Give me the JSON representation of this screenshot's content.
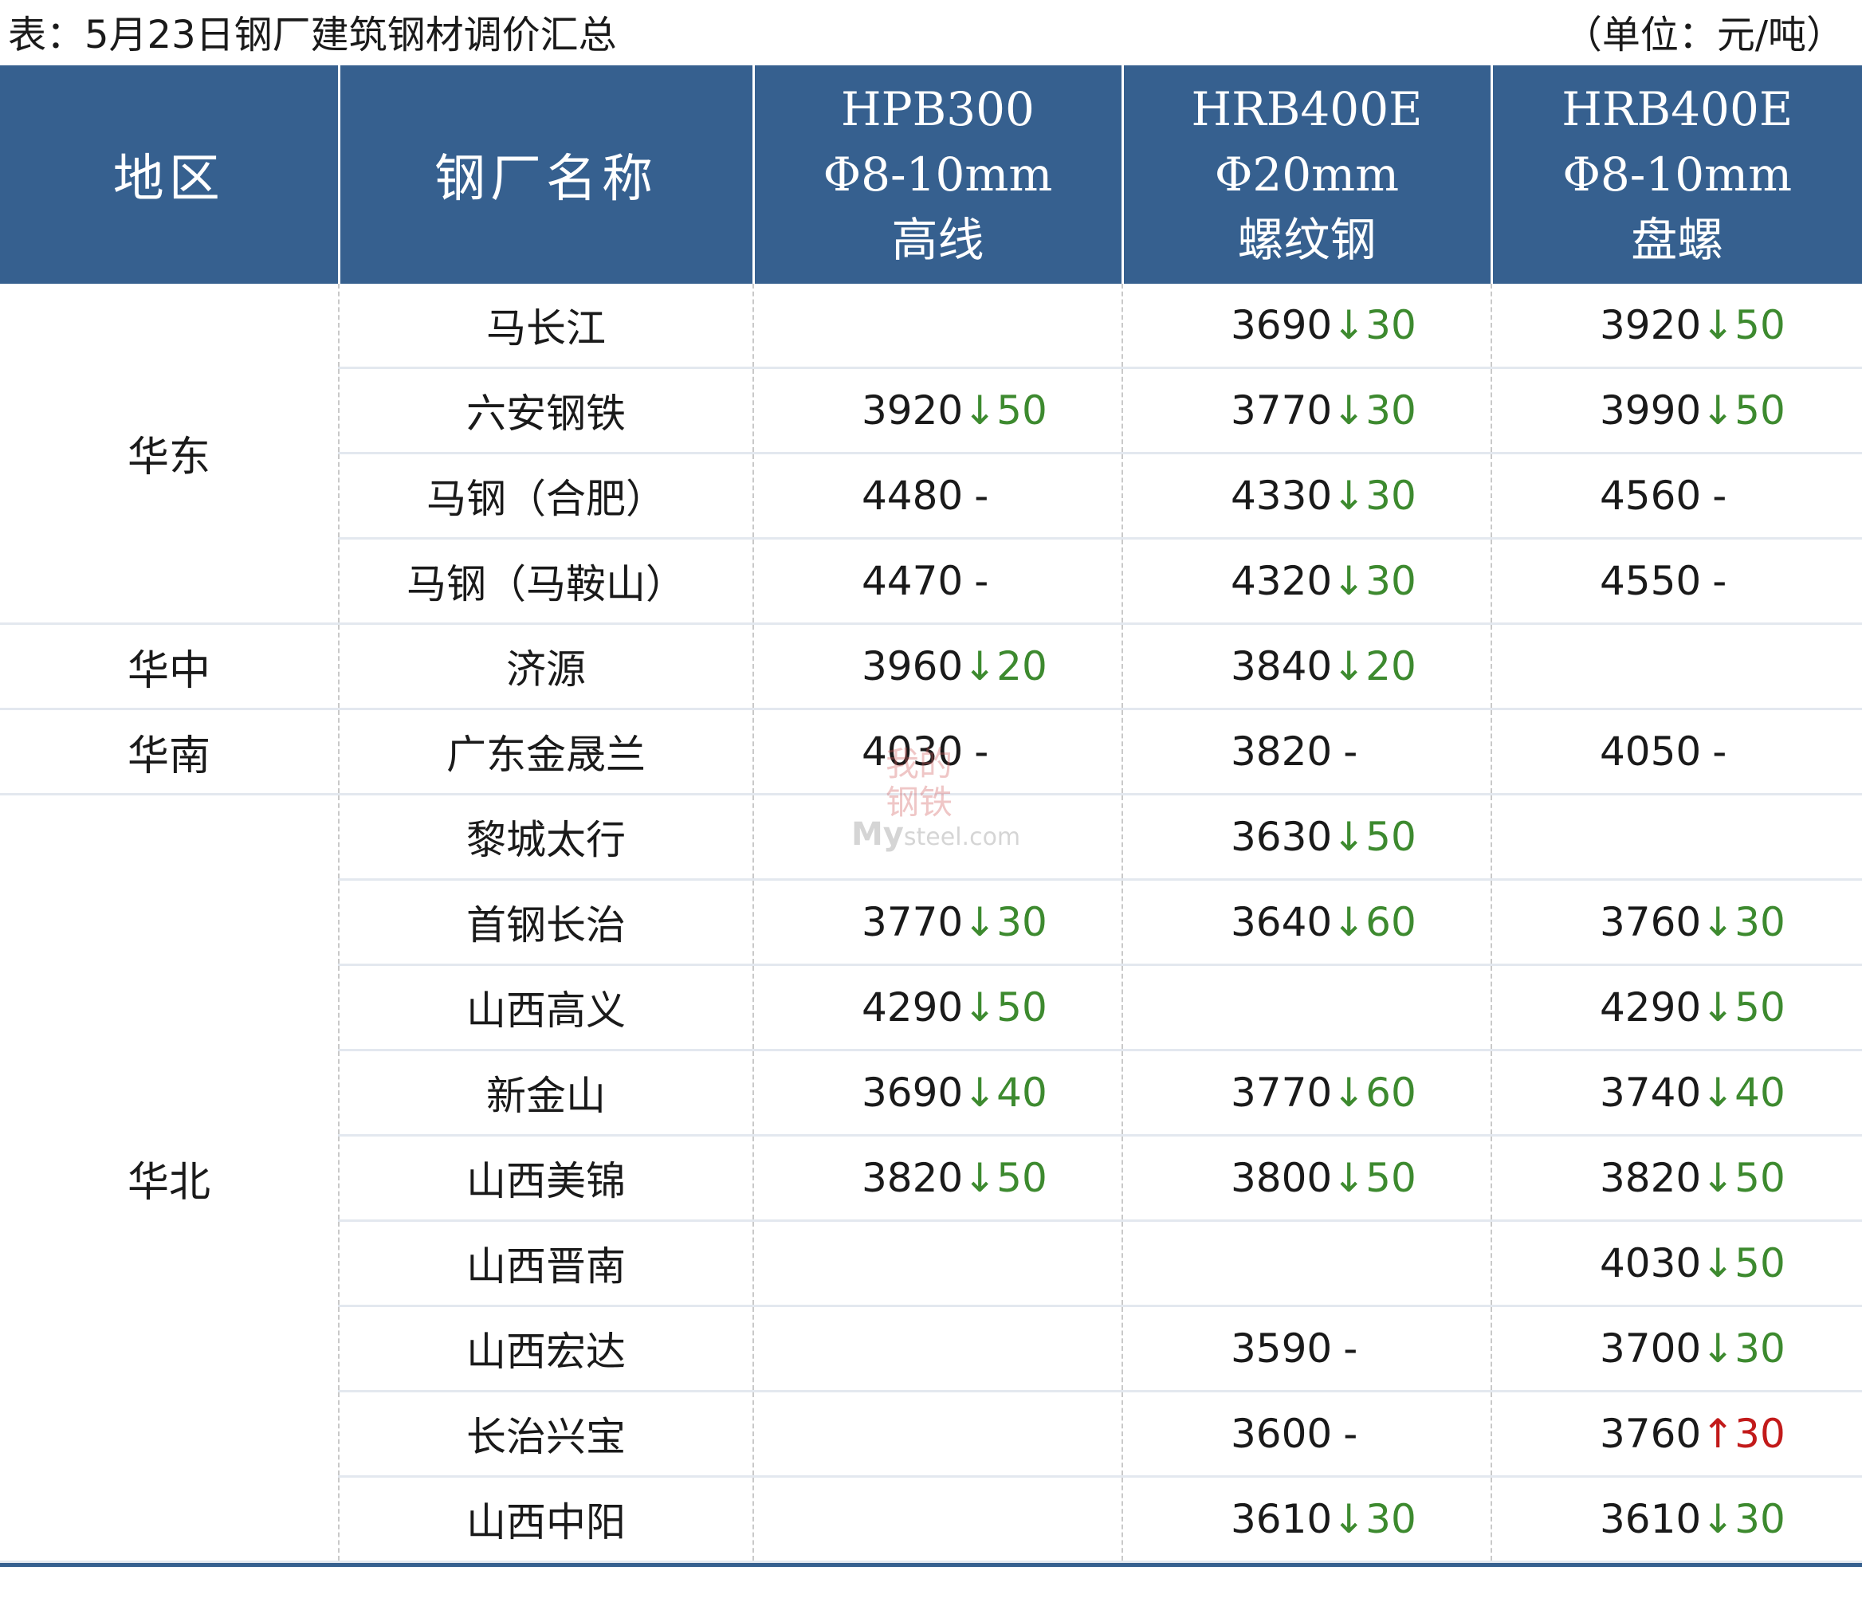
{
  "caption": {
    "title": "表：5月23日钢厂建筑钢材调价汇总",
    "unit": "（单位：元/吨）"
  },
  "colors": {
    "header_bg": "#36608f",
    "down": "#3d8a2f",
    "up": "#c21a1a",
    "row_divider": "#e3e8ef"
  },
  "header": {
    "region": "地区",
    "mill": "钢厂名称",
    "products": [
      {
        "grade": "HPB300",
        "spec": "Φ8-10mm",
        "type": "高线"
      },
      {
        "grade": "HRB400E",
        "spec": "Φ20mm",
        "type": "螺纹钢"
      },
      {
        "grade": "HRB400E",
        "spec": "Φ8-10mm",
        "type": "盘螺"
      }
    ]
  },
  "groups": [
    {
      "region": "华东",
      "rows": [
        {
          "mill": "马长江",
          "prices": [
            null,
            {
              "value": "3690",
              "dir": "down",
              "change": "↓30"
            },
            {
              "value": "3920",
              "dir": "down",
              "change": "↓50"
            }
          ]
        },
        {
          "mill": "六安钢铁",
          "prices": [
            {
              "value": "3920",
              "dir": "down",
              "change": "↓50"
            },
            {
              "value": "3770",
              "dir": "down",
              "change": "↓30"
            },
            {
              "value": "3990",
              "dir": "down",
              "change": "↓50"
            }
          ]
        },
        {
          "mill": "马钢（合肥）",
          "prices": [
            {
              "value": "4480",
              "dir": "flat",
              "change": "-"
            },
            {
              "value": "4330",
              "dir": "down",
              "change": "↓30"
            },
            {
              "value": "4560",
              "dir": "flat",
              "change": "-"
            }
          ]
        },
        {
          "mill": "马钢（马鞍山）",
          "prices": [
            {
              "value": "4470",
              "dir": "flat",
              "change": "-"
            },
            {
              "value": "4320",
              "dir": "down",
              "change": "↓30"
            },
            {
              "value": "4550",
              "dir": "flat",
              "change": "-"
            }
          ]
        }
      ]
    },
    {
      "region": "华中",
      "rows": [
        {
          "mill": "济源",
          "prices": [
            {
              "value": "3960",
              "dir": "down",
              "change": "↓20"
            },
            {
              "value": "3840",
              "dir": "down",
              "change": "↓20"
            },
            null
          ]
        }
      ]
    },
    {
      "region": "华南",
      "rows": [
        {
          "mill": "广东金晟兰",
          "prices": [
            {
              "value": "4030",
              "dir": "flat",
              "change": "-"
            },
            {
              "value": "3820",
              "dir": "flat",
              "change": "-"
            },
            {
              "value": "4050",
              "dir": "flat",
              "change": "-"
            }
          ]
        }
      ]
    },
    {
      "region": "华北",
      "rows": [
        {
          "mill": "黎城太行",
          "prices": [
            null,
            {
              "value": "3630",
              "dir": "down",
              "change": "↓50"
            },
            null
          ]
        },
        {
          "mill": "首钢长治",
          "prices": [
            {
              "value": "3770",
              "dir": "down",
              "change": "↓30"
            },
            {
              "value": "3640",
              "dir": "down",
              "change": "↓60"
            },
            {
              "value": "3760",
              "dir": "down",
              "change": "↓30"
            }
          ]
        },
        {
          "mill": "山西高义",
          "prices": [
            {
              "value": "4290",
              "dir": "down",
              "change": "↓50"
            },
            null,
            {
              "value": "4290",
              "dir": "down",
              "change": "↓50"
            }
          ]
        },
        {
          "mill": "新金山",
          "prices": [
            {
              "value": "3690",
              "dir": "down",
              "change": "↓40"
            },
            {
              "value": "3770",
              "dir": "down",
              "change": "↓60"
            },
            {
              "value": "3740",
              "dir": "down",
              "change": "↓40"
            }
          ]
        },
        {
          "mill": "山西美锦",
          "prices": [
            {
              "value": "3820",
              "dir": "down",
              "change": "↓50"
            },
            {
              "value": "3800",
              "dir": "down",
              "change": "↓50"
            },
            {
              "value": "3820",
              "dir": "down",
              "change": "↓50"
            }
          ]
        },
        {
          "mill": "山西晋南",
          "prices": [
            null,
            null,
            {
              "value": "4030",
              "dir": "down",
              "change": "↓50"
            }
          ]
        },
        {
          "mill": "山西宏达",
          "prices": [
            null,
            {
              "value": "3590",
              "dir": "flat",
              "change": "-"
            },
            {
              "value": "3700",
              "dir": "down",
              "change": "↓30"
            }
          ]
        },
        {
          "mill": "长治兴宝",
          "prices": [
            null,
            {
              "value": "3600",
              "dir": "flat",
              "change": "-"
            },
            {
              "value": "3760",
              "dir": "up",
              "change": "↑30"
            }
          ]
        },
        {
          "mill": "山西中阳",
          "prices": [
            null,
            {
              "value": "3610",
              "dir": "down",
              "change": "↓30"
            },
            {
              "value": "3610",
              "dir": "down",
              "change": "↓30"
            }
          ]
        }
      ]
    }
  ],
  "watermark": {
    "cn_text": "我的钢铁",
    "en_main": "My",
    "en_rest": "steel.com"
  }
}
